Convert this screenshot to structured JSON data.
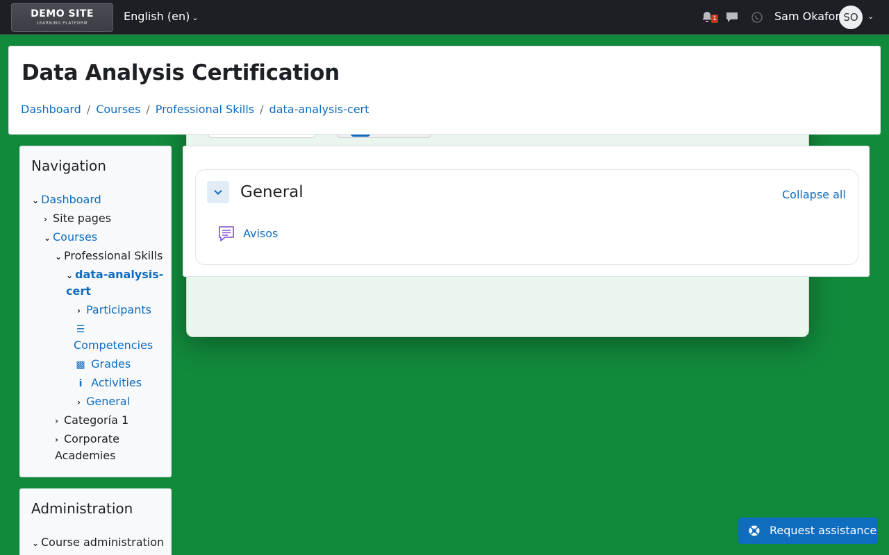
{
  "navbar": {
    "logo_title": "DEMO SITE",
    "logo_subtitle": "LEARNING PLATFORM",
    "language": "English (en)",
    "notification_count": "1",
    "user_name": "Sam Okafor",
    "user_initials": "SO"
  },
  "header": {
    "title": "Data Analysis Certification",
    "breadcrumb": [
      "Dashboard",
      "Courses",
      "Professional Skills",
      "data-analysis-cert"
    ]
  },
  "navigation_block": {
    "title": "Navigation",
    "items": {
      "dashboard": "Dashboard",
      "site_pages": "Site pages",
      "courses": "Courses",
      "professional_skills": "Professional Skills",
      "course_line1": "data-analysis-",
      "course_line2": "cert",
      "participants": "Participants",
      "competencies": "Competencies",
      "grades": "Grades",
      "activities": "Activities",
      "general": "General",
      "categoria": "Categoría 1",
      "corporate_line1": "Corporate",
      "corporate_line2": "Academies"
    }
  },
  "administration_block": {
    "title": "Administration",
    "items": {
      "course_administration": "Course administration"
    }
  },
  "course_content": {
    "section_title": "General",
    "collapse_all": "Collapse all",
    "activities": [
      {
        "name": "Avisos",
        "icon": "forum-icon"
      }
    ]
  },
  "assistance_button": "Request assistance",
  "colors": {
    "page_background": "#128a3c",
    "navbar": "#1c1f23",
    "link": "#0f6cbf",
    "badge": "#ca3120",
    "activity_icon": "#7a4dcf"
  }
}
